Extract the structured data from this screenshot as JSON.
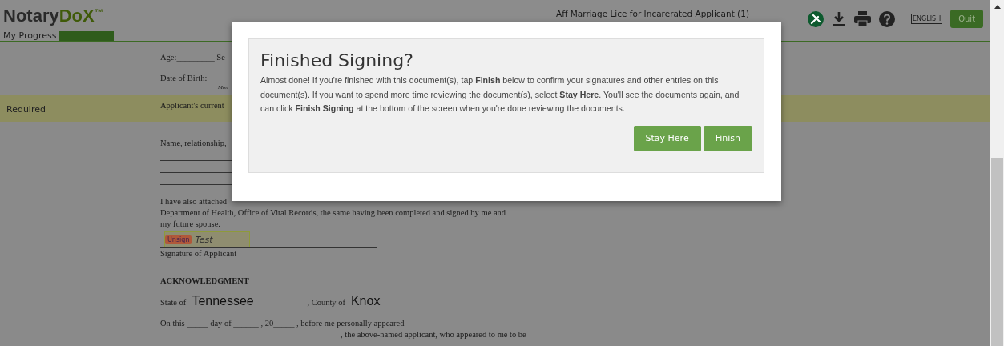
{
  "header": {
    "logo": {
      "part_1": "Notary",
      "part_2": "DoX",
      "mark": "™"
    },
    "progress": {
      "label": "My Progress"
    },
    "document_title": "Aff Marriage Lice for Incarerated Applicant (1)",
    "language": "ENGLISH",
    "quit": "Quit"
  },
  "sidebar": {
    "required_label": "Required"
  },
  "document": {
    "age": "Age:_________ Se",
    "dob": "Date of Birth:______",
    "dob_hint": "Mon",
    "current": "Applicant's current",
    "name_rel": "Name, relationship,",
    "attached": "I have also attached",
    "dept": "Department of Health, Office of Vital Records, the same having been completed and signed by me and",
    "spouse": "my future spouse.",
    "signature": {
      "unsign": "Unsign",
      "value": "Test",
      "label": "Signature of Applicant"
    },
    "heading": "ACKNOWLEDGMENT",
    "state_label": "State of",
    "state_value": "Tennessee",
    "county_label": ", County of",
    "county_value": "Knox",
    "on_this": "On this _____ day of ______ , 20_____ , before me personally appeared",
    "appeared": ", the above-named applicant, who appeared to me to be"
  },
  "modal": {
    "title": "Finished Signing?",
    "message": "Almost done! If you're finished with this document(s), tap **Finish** below to confirm your signatures and other entries on this document(s). If you want to spend more time reviewing the document(s), select **Stay Here**. You'll see the documents again, and can click **Finish Signing** at the bottom of the screen when you're done reviewing the documents.",
    "buttons": [
      "Stay Here",
      "Finish"
    ]
  }
}
